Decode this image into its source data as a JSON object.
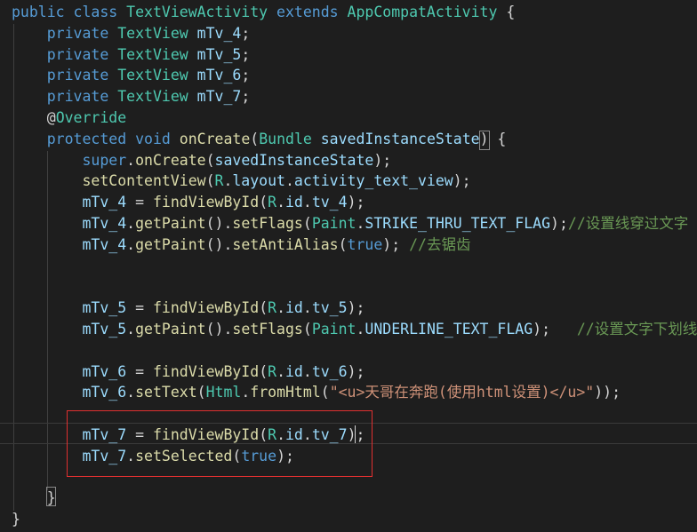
{
  "editor": {
    "lines": [
      {
        "tokens": [
          [
            "public",
            "kw"
          ],
          [
            " ",
            "df"
          ],
          [
            "class",
            "kw"
          ],
          [
            " ",
            "df"
          ],
          [
            "TextViewActivity",
            "ty"
          ],
          [
            " ",
            "df"
          ],
          [
            "extends",
            "kw"
          ],
          [
            " ",
            "df"
          ],
          [
            "AppCompatActivity",
            "ty"
          ],
          [
            " {",
            "df"
          ]
        ]
      },
      {
        "tokens": [
          [
            "    ",
            "df"
          ],
          [
            "private",
            "kw"
          ],
          [
            " ",
            "df"
          ],
          [
            "TextView",
            "ty"
          ],
          [
            " ",
            "df"
          ],
          [
            "mTv_4",
            "fld"
          ],
          [
            ";",
            "df"
          ]
        ]
      },
      {
        "tokens": [
          [
            "    ",
            "df"
          ],
          [
            "private",
            "kw"
          ],
          [
            " ",
            "df"
          ],
          [
            "TextView",
            "ty"
          ],
          [
            " ",
            "df"
          ],
          [
            "mTv_5",
            "fld"
          ],
          [
            ";",
            "df"
          ]
        ]
      },
      {
        "tokens": [
          [
            "    ",
            "df"
          ],
          [
            "private",
            "kw"
          ],
          [
            " ",
            "df"
          ],
          [
            "TextView",
            "ty"
          ],
          [
            " ",
            "df"
          ],
          [
            "mTv_6",
            "fld"
          ],
          [
            ";",
            "df"
          ]
        ]
      },
      {
        "tokens": [
          [
            "    ",
            "df"
          ],
          [
            "private",
            "kw"
          ],
          [
            " ",
            "df"
          ],
          [
            "TextView",
            "ty"
          ],
          [
            " ",
            "df"
          ],
          [
            "mTv_7",
            "fld"
          ],
          [
            ";",
            "df"
          ]
        ]
      },
      {
        "tokens": [
          [
            "    ",
            "df"
          ],
          [
            "@",
            "df"
          ],
          [
            "Override",
            "ty"
          ]
        ]
      },
      {
        "tokens": [
          [
            "    ",
            "df"
          ],
          [
            "protected",
            "kw"
          ],
          [
            " ",
            "df"
          ],
          [
            "void",
            "kw"
          ],
          [
            " ",
            "df"
          ],
          [
            "onCreate",
            "fn"
          ],
          [
            "(",
            "df"
          ],
          [
            "Bundle",
            "ty"
          ],
          [
            " ",
            "df"
          ],
          [
            "savedInstanceState",
            "fld"
          ],
          [
            ") {",
            "df"
          ]
        ]
      },
      {
        "tokens": [
          [
            "        ",
            "df"
          ],
          [
            "super",
            "kw"
          ],
          [
            ".",
            "df"
          ],
          [
            "onCreate",
            "fn"
          ],
          [
            "(",
            "df"
          ],
          [
            "savedInstanceState",
            "fld"
          ],
          [
            ");",
            "df"
          ]
        ]
      },
      {
        "tokens": [
          [
            "        ",
            "df"
          ],
          [
            "setContentView",
            "fn"
          ],
          [
            "(",
            "df"
          ],
          [
            "R",
            "ty"
          ],
          [
            ".",
            "df"
          ],
          [
            "layout",
            "fld"
          ],
          [
            ".",
            "df"
          ],
          [
            "activity_text_view",
            "fld"
          ],
          [
            ");",
            "df"
          ]
        ]
      },
      {
        "tokens": [
          [
            "        ",
            "df"
          ],
          [
            "mTv_4",
            "fld"
          ],
          [
            " = ",
            "df"
          ],
          [
            "findViewById",
            "fn"
          ],
          [
            "(",
            "df"
          ],
          [
            "R",
            "ty"
          ],
          [
            ".",
            "df"
          ],
          [
            "id",
            "fld"
          ],
          [
            ".",
            "df"
          ],
          [
            "tv_4",
            "fld"
          ],
          [
            ");",
            "df"
          ]
        ]
      },
      {
        "tokens": [
          [
            "        ",
            "df"
          ],
          [
            "mTv_4",
            "fld"
          ],
          [
            ".",
            "df"
          ],
          [
            "getPaint",
            "fn"
          ],
          [
            "().",
            "df"
          ],
          [
            "setFlags",
            "fn"
          ],
          [
            "(",
            "df"
          ],
          [
            "Paint",
            "ty"
          ],
          [
            ".",
            "df"
          ],
          [
            "STRIKE_THRU_TEXT_FLAG",
            "fld"
          ],
          [
            ");",
            "df"
          ],
          [
            "//设置线穿过文字",
            "cm"
          ]
        ]
      },
      {
        "tokens": [
          [
            "        ",
            "df"
          ],
          [
            "mTv_4",
            "fld"
          ],
          [
            ".",
            "df"
          ],
          [
            "getPaint",
            "fn"
          ],
          [
            "().",
            "df"
          ],
          [
            "setAntiAlias",
            "fn"
          ],
          [
            "(",
            "df"
          ],
          [
            "true",
            "kw"
          ],
          [
            "); ",
            "df"
          ],
          [
            "//去锯齿",
            "cm"
          ]
        ]
      },
      {
        "tokens": []
      },
      {
        "tokens": []
      },
      {
        "tokens": [
          [
            "        ",
            "df"
          ],
          [
            "mTv_5",
            "fld"
          ],
          [
            " = ",
            "df"
          ],
          [
            "findViewById",
            "fn"
          ],
          [
            "(",
            "df"
          ],
          [
            "R",
            "ty"
          ],
          [
            ".",
            "df"
          ],
          [
            "id",
            "fld"
          ],
          [
            ".",
            "df"
          ],
          [
            "tv_5",
            "fld"
          ],
          [
            ");",
            "df"
          ]
        ]
      },
      {
        "tokens": [
          [
            "        ",
            "df"
          ],
          [
            "mTv_5",
            "fld"
          ],
          [
            ".",
            "df"
          ],
          [
            "getPaint",
            "fn"
          ],
          [
            "().",
            "df"
          ],
          [
            "setFlags",
            "fn"
          ],
          [
            "(",
            "df"
          ],
          [
            "Paint",
            "ty"
          ],
          [
            ".",
            "df"
          ],
          [
            "UNDERLINE_TEXT_FLAG",
            "fld"
          ],
          [
            ");   ",
            "df"
          ],
          [
            "//设置文字下划线",
            "cm"
          ]
        ]
      },
      {
        "tokens": []
      },
      {
        "tokens": [
          [
            "        ",
            "df"
          ],
          [
            "mTv_6",
            "fld"
          ],
          [
            " = ",
            "df"
          ],
          [
            "findViewById",
            "fn"
          ],
          [
            "(",
            "df"
          ],
          [
            "R",
            "ty"
          ],
          [
            ".",
            "df"
          ],
          [
            "id",
            "fld"
          ],
          [
            ".",
            "df"
          ],
          [
            "tv_6",
            "fld"
          ],
          [
            ");",
            "df"
          ]
        ]
      },
      {
        "tokens": [
          [
            "        ",
            "df"
          ],
          [
            "mTv_6",
            "fld"
          ],
          [
            ".",
            "df"
          ],
          [
            "setText",
            "fn"
          ],
          [
            "(",
            "df"
          ],
          [
            "Html",
            "ty"
          ],
          [
            ".",
            "df"
          ],
          [
            "fromHtml",
            "fn"
          ],
          [
            "(",
            "df"
          ],
          [
            "\"<u>天哥在奔跑(使用html设置)</u>\"",
            "str"
          ],
          [
            "));",
            "df"
          ]
        ]
      },
      {
        "tokens": []
      },
      {
        "tokens": [
          [
            "        ",
            "df"
          ],
          [
            "mTv_7",
            "fld"
          ],
          [
            " = ",
            "df"
          ],
          [
            "findViewById",
            "fn"
          ],
          [
            "(",
            "df"
          ],
          [
            "R",
            "ty"
          ],
          [
            ".",
            "df"
          ],
          [
            "id",
            "fld"
          ],
          [
            ".",
            "df"
          ],
          [
            "tv_7",
            "fld"
          ],
          [
            ");",
            "df"
          ]
        ]
      },
      {
        "tokens": [
          [
            "        ",
            "df"
          ],
          [
            "mTv_7",
            "fld"
          ],
          [
            ".",
            "df"
          ],
          [
            "setSelected",
            "fn"
          ],
          [
            "(",
            "df"
          ],
          [
            "true",
            "kw"
          ],
          [
            ");",
            "df"
          ]
        ]
      },
      {
        "tokens": []
      },
      {
        "tokens": [
          [
            "    ",
            "df"
          ],
          [
            "}",
            "df"
          ]
        ]
      },
      {
        "tokens": [
          [
            "}",
            "df"
          ]
        ]
      }
    ]
  },
  "colors": {
    "background": "#1e1e1e",
    "keyword": "#569cd6",
    "type": "#4ec9b0",
    "field": "#9cdcfe",
    "function": "#dcdcaa",
    "string": "#ce9178",
    "comment": "#6a9955",
    "default": "#d4d4d4",
    "selection_box": "#e03030"
  }
}
